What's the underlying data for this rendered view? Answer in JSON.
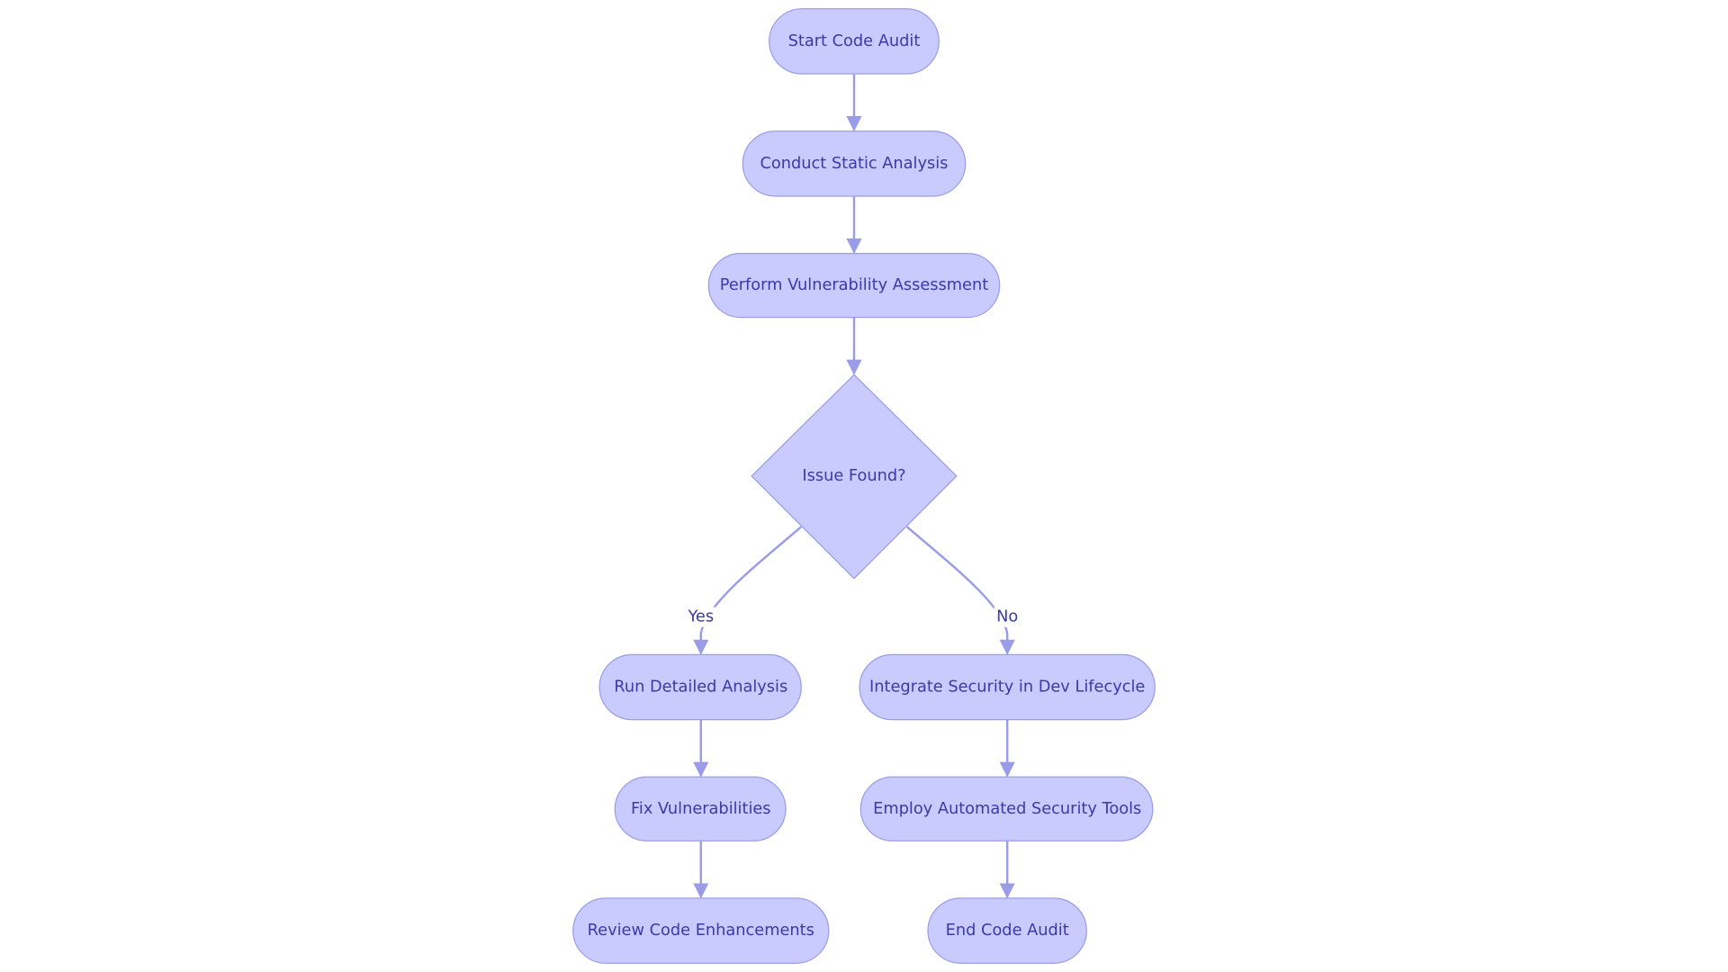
{
  "colors": {
    "node_fill": "#c9cbff",
    "node_stroke": "#9a9ce8",
    "text": "#3a3aa8",
    "edge": "#9a9ce8"
  },
  "nodes": {
    "start": "Start Code Audit",
    "static": "Conduct Static Analysis",
    "vuln": "Perform Vulnerability Assessment",
    "decision": "Issue Found?",
    "detailed": "Run Detailed Analysis",
    "integrate": "Integrate Security in Dev Lifecycle",
    "fix": "Fix Vulnerabilities",
    "employ": "Employ Automated Security Tools",
    "review": "Review Code Enhancements",
    "end": "End Code Audit"
  },
  "edges": {
    "yes": "Yes",
    "no": "No"
  }
}
